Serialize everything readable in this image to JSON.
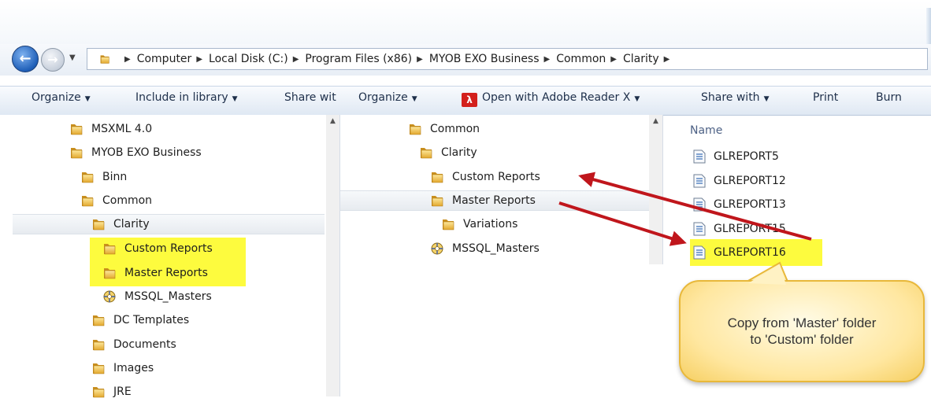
{
  "address": {
    "crumbs": [
      "Computer",
      "Local Disk (C:)",
      "Program Files (x86)",
      "MYOB EXO Business",
      "Common",
      "Clarity"
    ]
  },
  "toolbar_left": {
    "organize": "Organize",
    "include": "Include in library",
    "share": "Share wit"
  },
  "toolbar_right": {
    "organize": "Organize",
    "open_with": "Open with Adobe Reader X",
    "share": "Share with",
    "print": "Print",
    "burn": "Burn"
  },
  "left_tree": [
    {
      "label": "MSXML 4.0",
      "icon": "folder-icon"
    },
    {
      "label": "MYOB EXO Business",
      "icon": "folder-icon"
    },
    {
      "label": "Binn",
      "icon": "folder-icon"
    },
    {
      "label": "Common",
      "icon": "folder-icon"
    },
    {
      "label": "Clarity",
      "icon": "folder-icon"
    },
    {
      "label": "Custom Reports",
      "icon": "folder-icon"
    },
    {
      "label": "Master Reports",
      "icon": "folder-icon"
    },
    {
      "label": "MSSQL_Masters",
      "icon": "database-icon"
    },
    {
      "label": "DC Templates",
      "icon": "folder-icon"
    },
    {
      "label": "Documents",
      "icon": "folder-icon"
    },
    {
      "label": "Images",
      "icon": "folder-icon"
    },
    {
      "label": "JRE",
      "icon": "folder-icon"
    }
  ],
  "middle_tree": [
    {
      "label": "Common",
      "icon": "folder-icon"
    },
    {
      "label": "Clarity",
      "icon": "folder-icon"
    },
    {
      "label": "Custom Reports",
      "icon": "folder-icon"
    },
    {
      "label": "Master Reports",
      "icon": "folder-icon"
    },
    {
      "label": "Variations",
      "icon": "folder-icon"
    },
    {
      "label": "MSSQL_Masters",
      "icon": "database-icon"
    }
  ],
  "files": {
    "column_header": "Name",
    "items": [
      "GLREPORT5",
      "GLREPORT12",
      "GLREPORT13",
      "GLREPORT15",
      "GLREPORT16"
    ]
  },
  "callout": {
    "line1": "Copy from 'Master' folder",
    "line2": "to 'Custom' folder"
  },
  "colors": {
    "highlight": "#fdfb3e",
    "arrow": "#c0161c",
    "folder": "#e9b43a"
  }
}
